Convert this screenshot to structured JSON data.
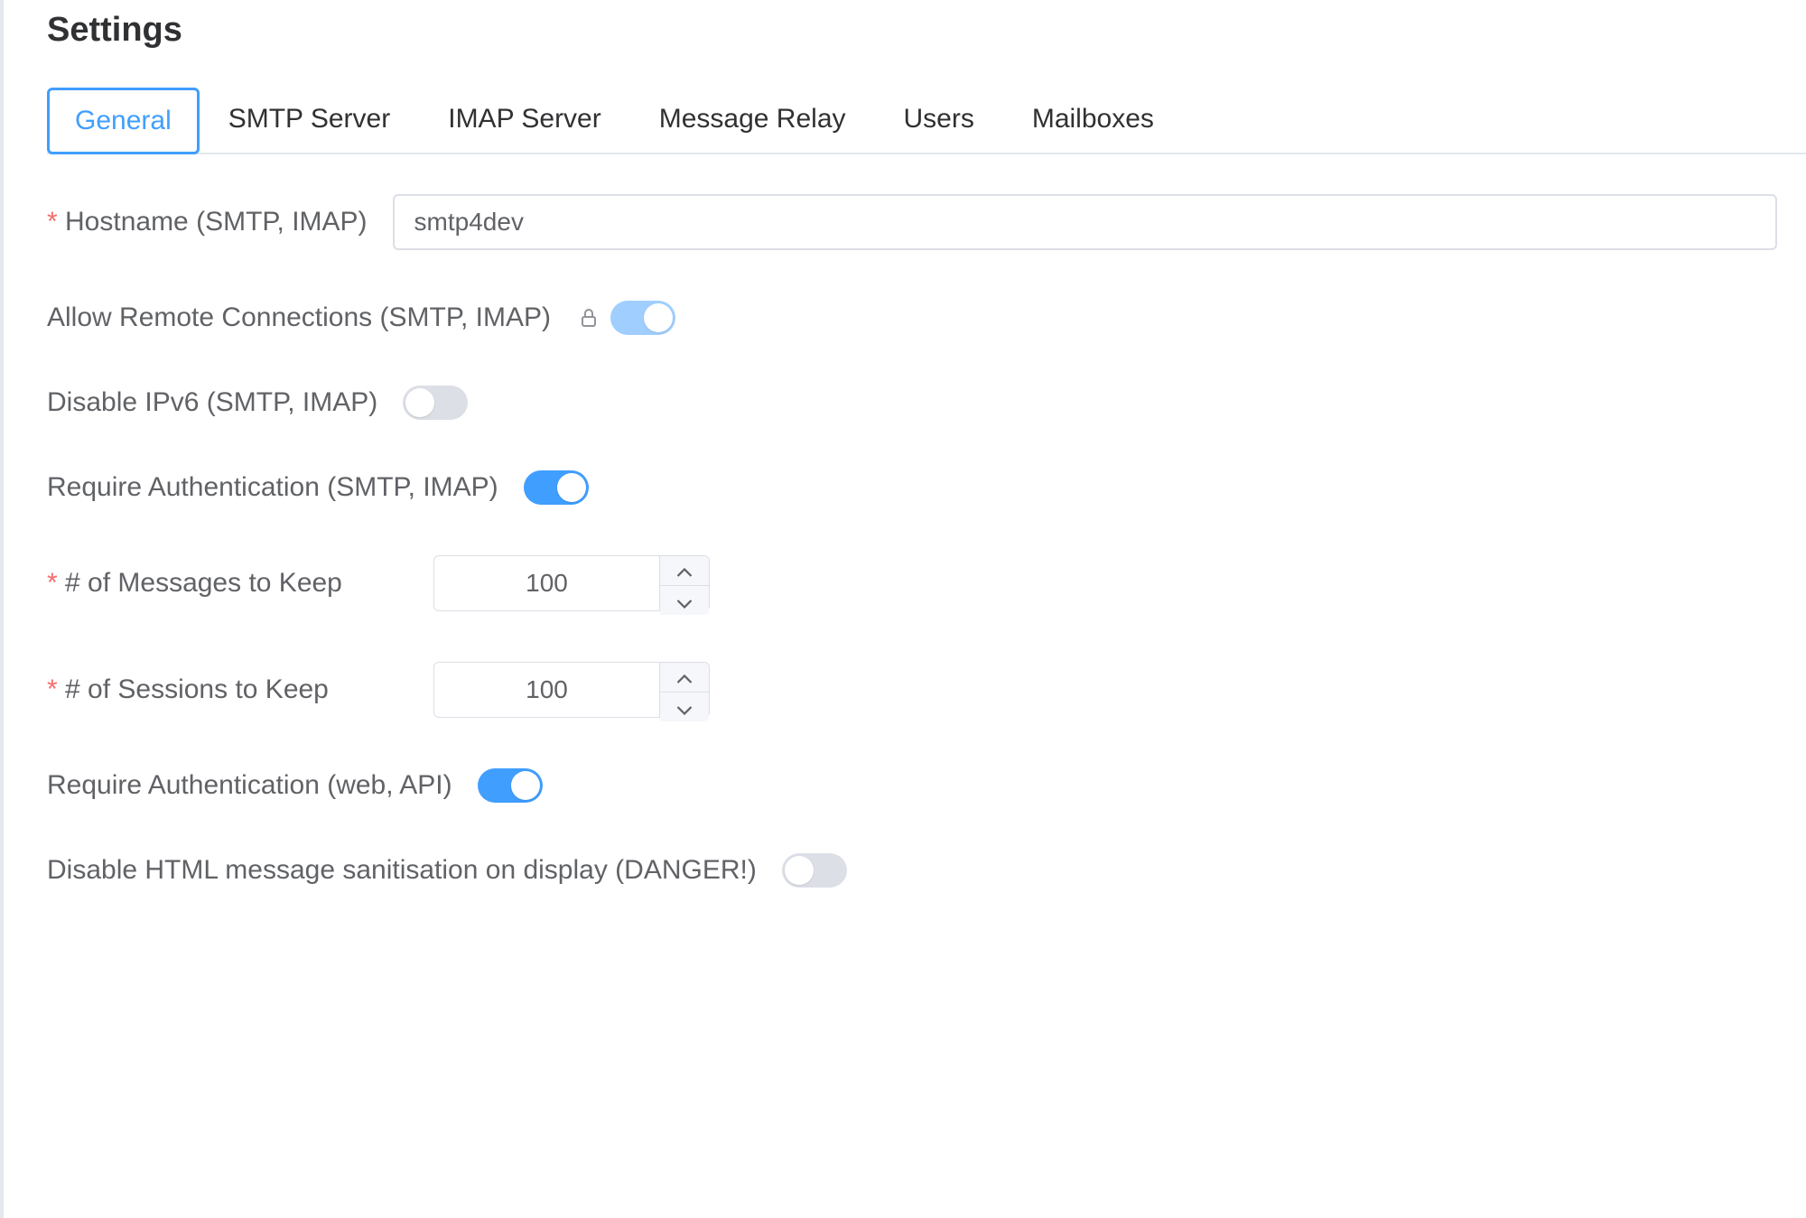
{
  "page_title": "Settings",
  "tabs": [
    {
      "label": "General",
      "active": true
    },
    {
      "label": "SMTP Server",
      "active": false
    },
    {
      "label": "IMAP Server",
      "active": false
    },
    {
      "label": "Message Relay",
      "active": false
    },
    {
      "label": "Users",
      "active": false
    },
    {
      "label": "Mailboxes",
      "active": false
    }
  ],
  "general": {
    "hostname": {
      "label": "Hostname (SMTP, IMAP)",
      "required": true,
      "value": "smtp4dev"
    },
    "allow_remote": {
      "label": "Allow Remote Connections (SMTP, IMAP)",
      "locked": true,
      "value": true
    },
    "disable_ipv6": {
      "label": "Disable IPv6 (SMTP, IMAP)",
      "value": false
    },
    "require_auth_smtp_imap": {
      "label": "Require Authentication (SMTP, IMAP)",
      "value": true
    },
    "messages_to_keep": {
      "label": "# of Messages to Keep",
      "required": true,
      "value": 100
    },
    "sessions_to_keep": {
      "label": "# of Sessions to Keep",
      "required": true,
      "value": 100
    },
    "require_auth_web_api": {
      "label": "Require Authentication (web, API)",
      "value": true
    },
    "disable_sanitisation": {
      "label": "Disable HTML message sanitisation on display (DANGER!)",
      "value": false
    }
  }
}
